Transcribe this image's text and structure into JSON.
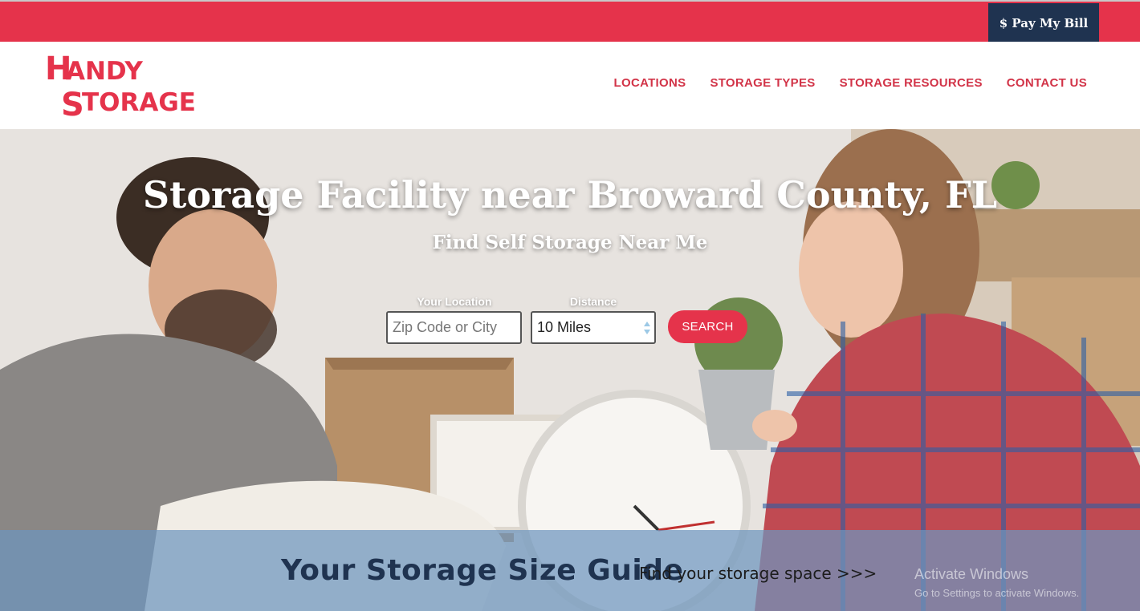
{
  "topbar": {
    "pay_label": "$ Pay My Bill"
  },
  "logo": {
    "line1": "HANDY",
    "line2": "STORAGE"
  },
  "nav": {
    "items": [
      {
        "label": "LOCATIONS"
      },
      {
        "label": "STORAGE TYPES"
      },
      {
        "label": "STORAGE RESOURCES"
      },
      {
        "label": "CONTACT US"
      }
    ]
  },
  "hero": {
    "title": "Storage Facility near Broward County, FL",
    "subtitle": "Find Self Storage Near Me",
    "location_label": "Your Location",
    "location_placeholder": "Zip Code or City",
    "distance_label": "Distance",
    "distance_value": "10 Miles",
    "search_label": "SEARCH"
  },
  "guide": {
    "title": "Your Storage Size Guide",
    "link": "Find your storage space >>>"
  },
  "watermark": {
    "title": "Activate Windows",
    "subtitle": "Go to Settings to activate Windows."
  },
  "colors": {
    "brand_red": "#e5334b",
    "navy": "#1f3350",
    "guide_band": "#6e96be"
  }
}
